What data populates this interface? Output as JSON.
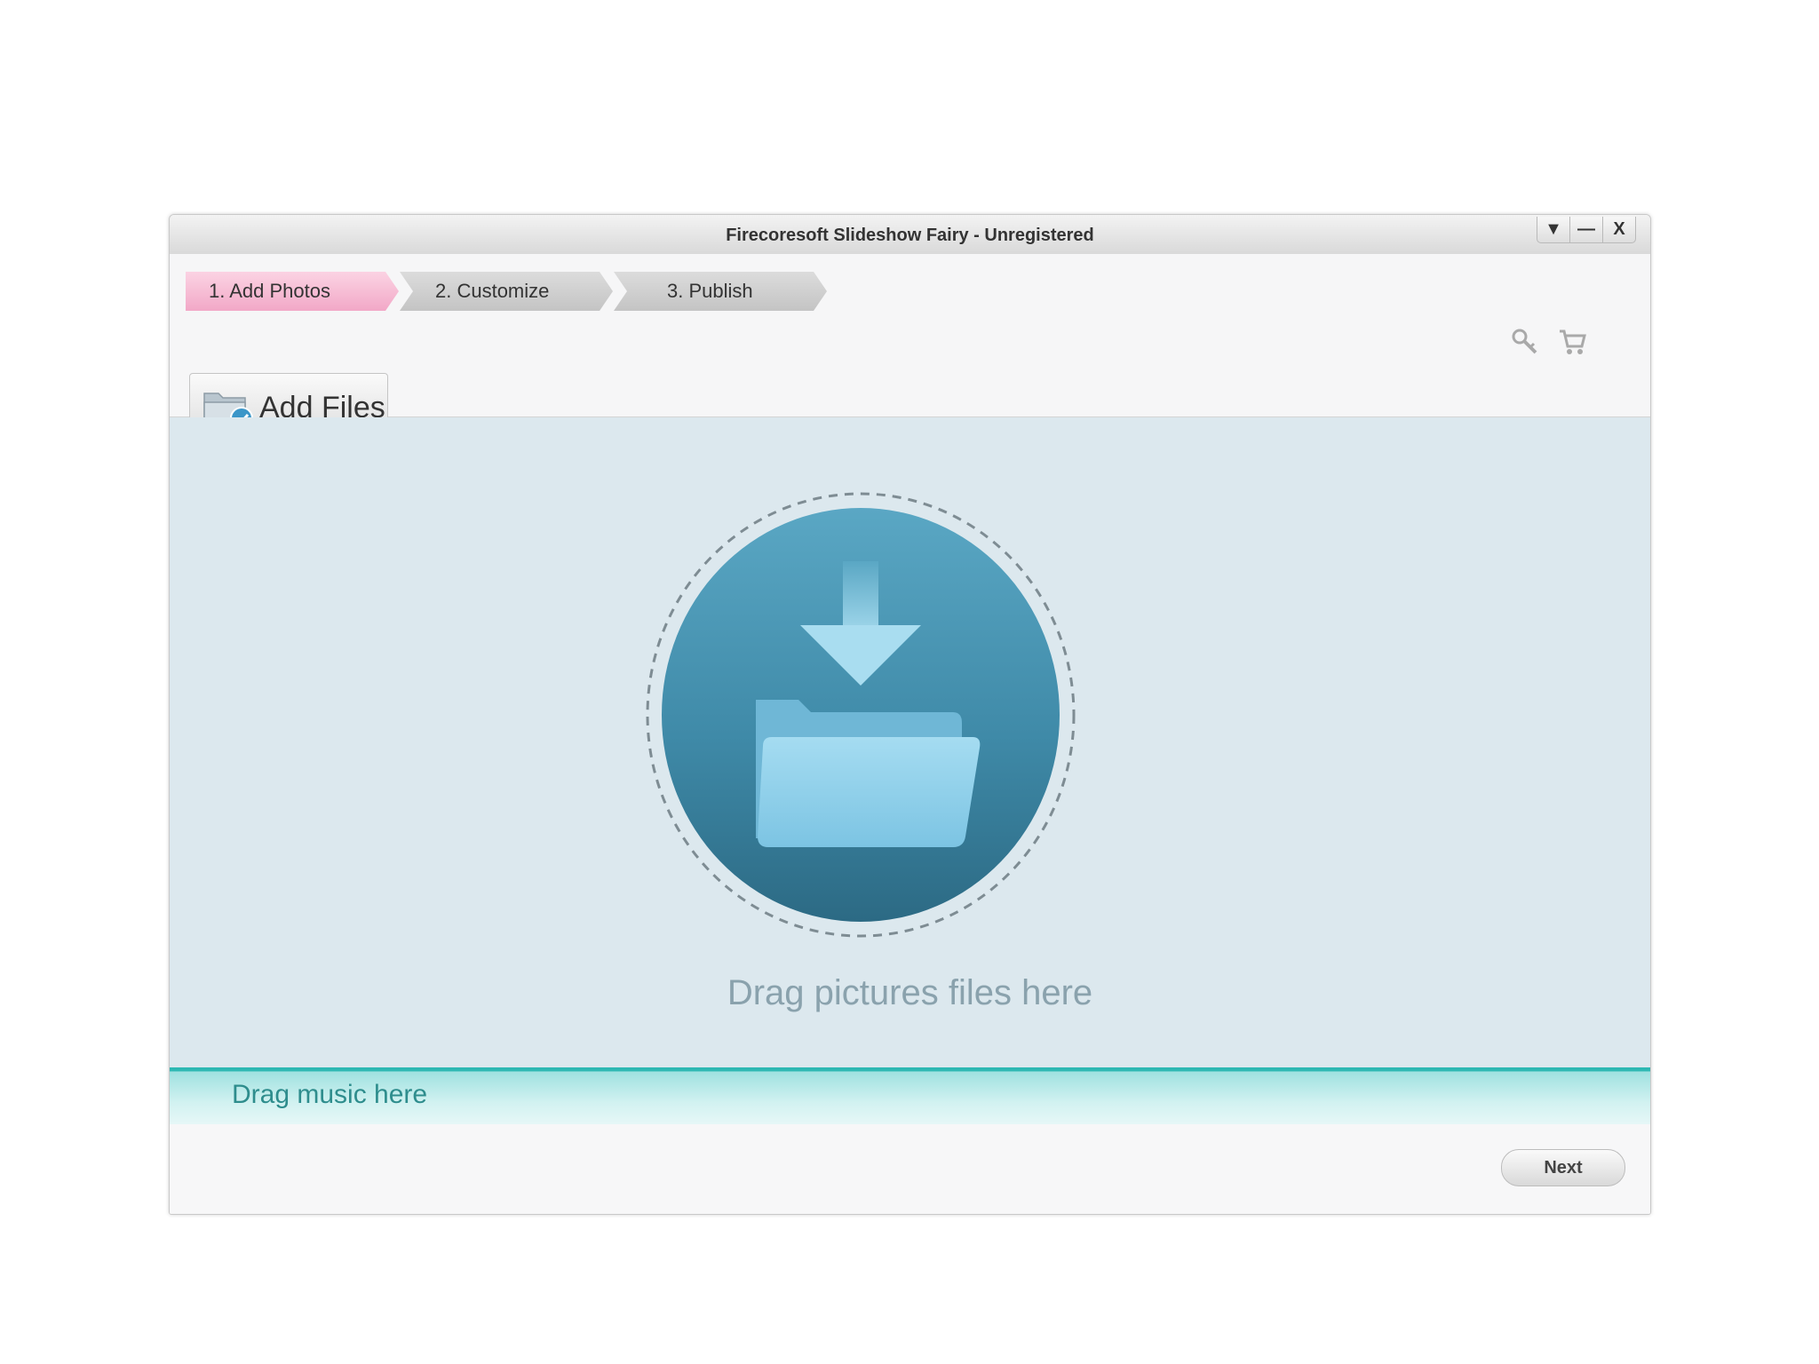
{
  "window": {
    "title": "Firecoresoft Slideshow Fairy - Unregistered",
    "controls": {
      "menu_symbol": "▼",
      "minimize_symbol": "—",
      "close_symbol": "X"
    }
  },
  "steps": [
    {
      "label": "1.  Add Photos",
      "active": true
    },
    {
      "label": "2.  Customize",
      "active": false
    },
    {
      "label": "3.  Publish",
      "active": false
    }
  ],
  "header_icons": [
    "key-icon",
    "cart-icon"
  ],
  "toolbar": {
    "add_files_label": "Add Files",
    "add_files_icon": "folder-add-icon"
  },
  "drop_area": {
    "hint": "Drag pictures files here",
    "icon": "download-folder-icon"
  },
  "music_bar": {
    "hint": "Drag music here"
  },
  "footer": {
    "next_label": "Next"
  },
  "colors": {
    "active_step": "#f2a8c7",
    "inactive_step": "#c4c4c4",
    "drop_area_bg": "#dce8ee",
    "music_accent": "#2eb8b3",
    "circle_blue": "#3f8aa8"
  }
}
